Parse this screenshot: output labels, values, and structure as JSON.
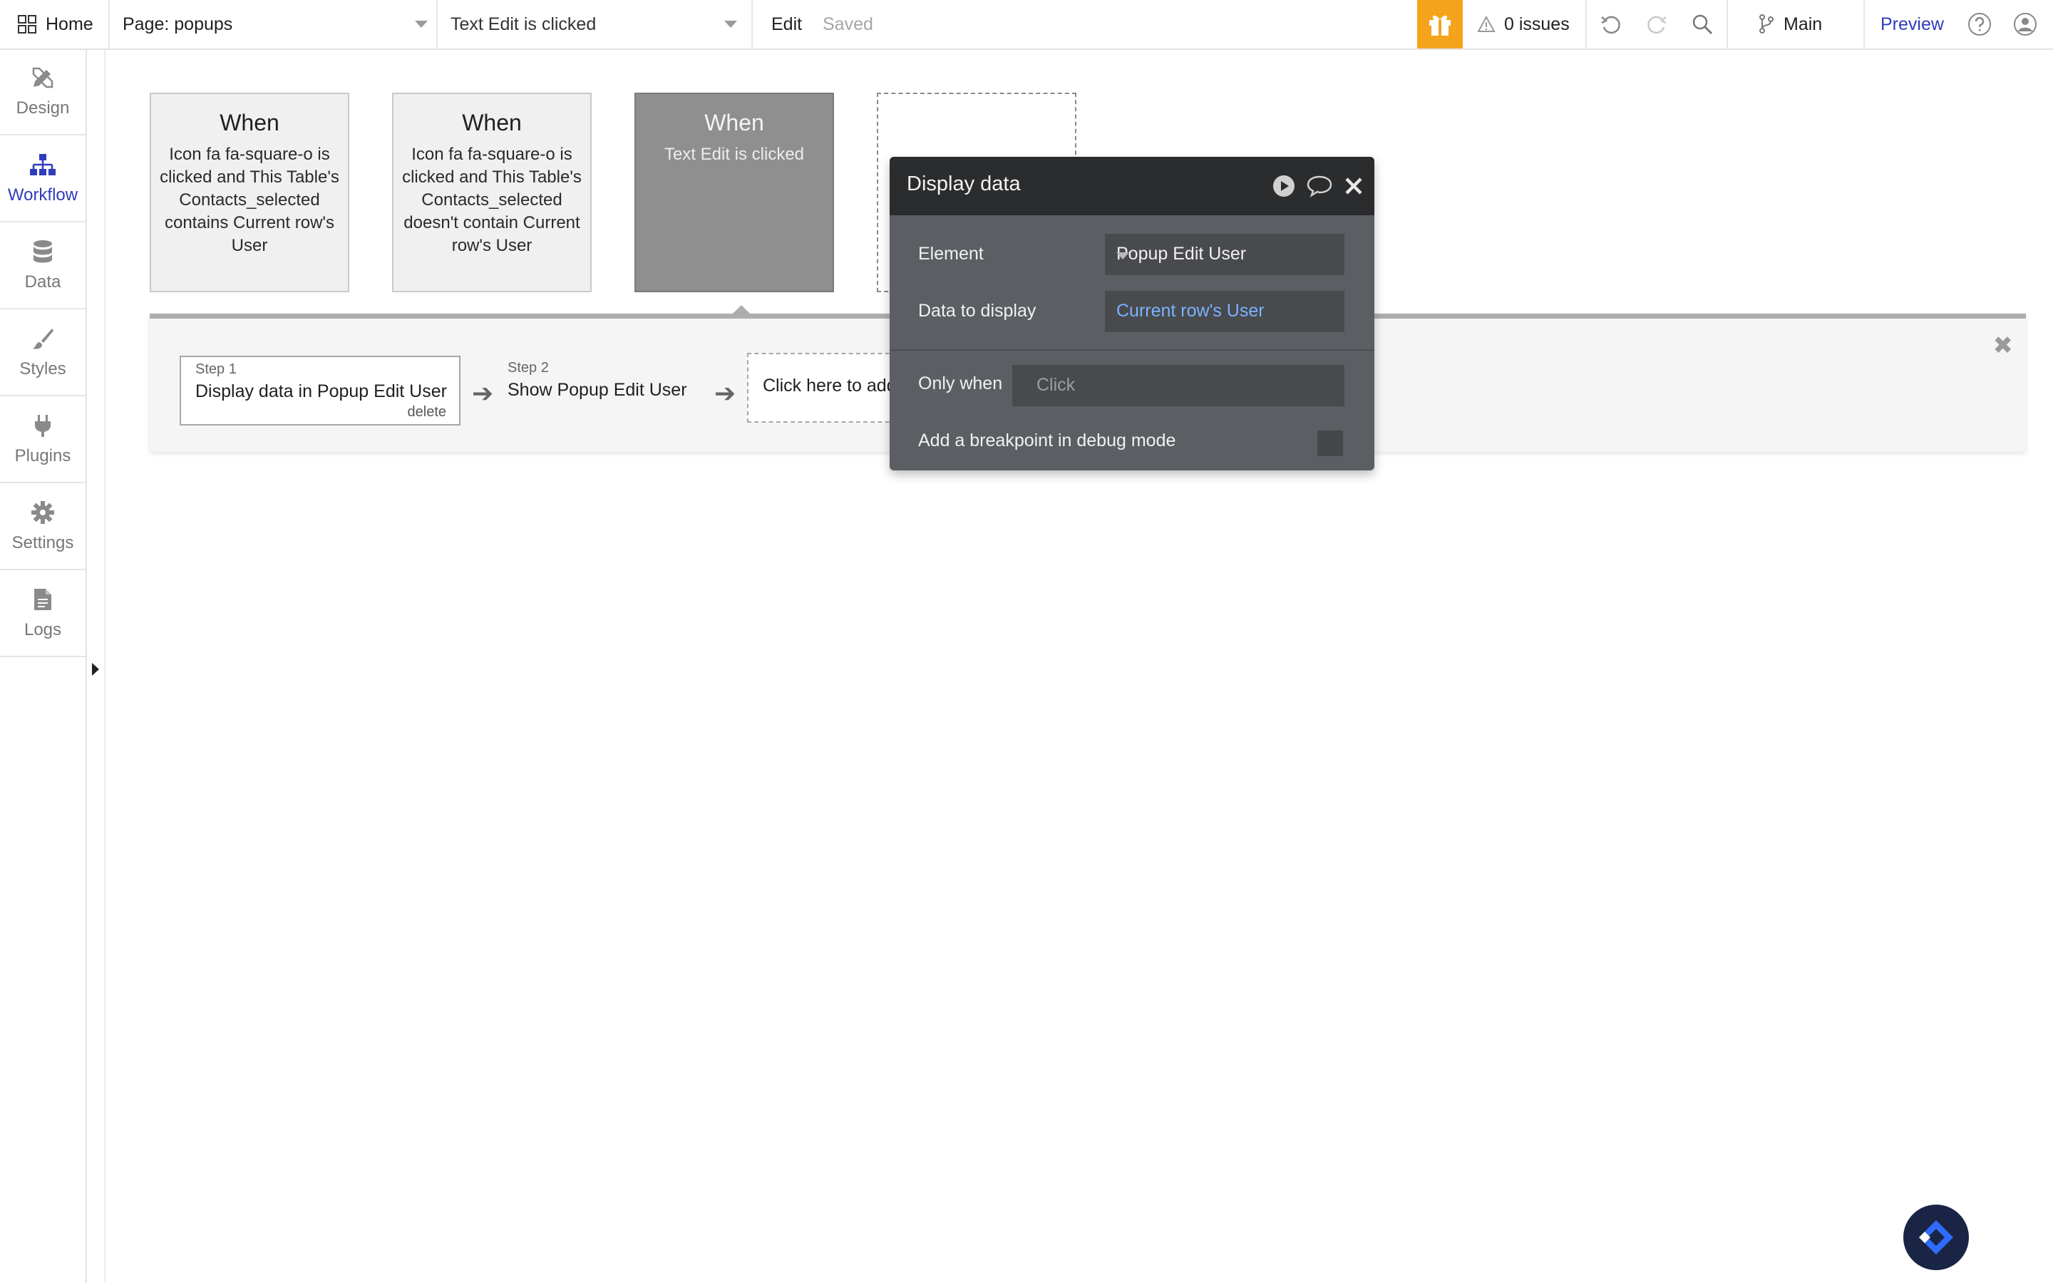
{
  "topbar": {
    "home_label": "Home",
    "page_label": "Page: popups",
    "event_label": "Text Edit is clicked",
    "edit_label": "Edit",
    "saved_label": "Saved",
    "issues_label": "0 issues",
    "branch_label": "Main",
    "preview_label": "Preview"
  },
  "sidebar": {
    "items": [
      {
        "label": "Design",
        "icon": "design-icon"
      },
      {
        "label": "Workflow",
        "icon": "workflow-icon"
      },
      {
        "label": "Data",
        "icon": "database-icon"
      },
      {
        "label": "Styles",
        "icon": "brush-icon"
      },
      {
        "label": "Plugins",
        "icon": "plug-icon"
      },
      {
        "label": "Settings",
        "icon": "gear-icon"
      },
      {
        "label": "Logs",
        "icon": "document-icon"
      }
    ]
  },
  "events": [
    {
      "when": "When",
      "condition": "Icon fa fa-square-o is clicked and This Table's Contacts_selected contains Current row's User"
    },
    {
      "when": "When",
      "condition": "Icon fa fa-square-o is clicked and This Table's Contacts_selected doesn't contain Current row's User"
    },
    {
      "when": "When",
      "condition": "Text Edit is clicked"
    }
  ],
  "steps": [
    {
      "num": "Step 1",
      "title": "Display data in Popup Edit User",
      "delete": "delete"
    },
    {
      "num": "Step 2",
      "title": "Show Popup Edit User"
    }
  ],
  "add_action_label": "Click here to add",
  "modal": {
    "title": "Display data",
    "element_label": "Element",
    "element_value": "Popup Edit User",
    "data_label": "Data to display",
    "data_value": "Current row's User",
    "only_when_label": "Only when",
    "only_when_placeholder": "Click",
    "breakpoint_label": "Add a breakpoint in debug mode"
  },
  "colors": {
    "accent": "#2f3cbd",
    "gift": "#f4a41c",
    "modal_bg": "#5b5e62",
    "modal_header": "#2b2c2e",
    "link": "#7ab3ff"
  }
}
